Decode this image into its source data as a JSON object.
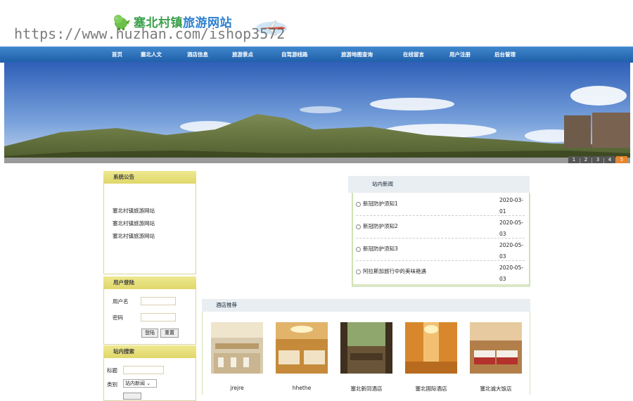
{
  "site": {
    "title_part1": "塞北村镇",
    "title_part2": "旅游网站",
    "watermark": "https://www.huzhan.com/ishop3572"
  },
  "nav": [
    "首页",
    "塞北人文",
    "酒店信息",
    "旅游景点",
    "自驾游线路",
    "旅游地图查询",
    "在线留言",
    "用户注册",
    "后台管理"
  ],
  "banner": {
    "pages": [
      "1",
      "2",
      "3",
      "4",
      "5"
    ],
    "active_page": "5"
  },
  "notice": {
    "title": "系统公告",
    "items": [
      "塞北村镇旅游网站",
      "塞北村镇旅游网站",
      "塞北村镇旅游网站"
    ]
  },
  "login": {
    "title": "用户登陆",
    "username_label": "用户名",
    "password_label": "密码",
    "login_button": "登陆",
    "reset_button": "重置"
  },
  "search": {
    "title": "站内搜索",
    "title_label": "标题",
    "category_label": "类别",
    "category_value": "站内新闻"
  },
  "news": {
    "title": "站内新闻",
    "items": [
      {
        "title": "新冠防护须知1",
        "date": "2020-03-01"
      },
      {
        "title": "新冠防护须知2",
        "date": "2020-05-03"
      },
      {
        "title": "新冠防护须知3",
        "date": "2020-05-03"
      },
      {
        "title": "阿拉斯加旅行中的美味艳遇",
        "date": "2020-05-03"
      }
    ]
  },
  "hotels": {
    "title": "酒店推荐",
    "items": [
      {
        "name": "jrejre"
      },
      {
        "name": "hhethe"
      },
      {
        "name": "塞北新同酒店"
      },
      {
        "name": "塞北国际酒店"
      },
      {
        "name": "塞北诚大饭店"
      }
    ]
  },
  "colors": {
    "nav_bg": "#2a6cb6",
    "panel_head": "#e6df7a",
    "pager_active": "#e8852a"
  }
}
